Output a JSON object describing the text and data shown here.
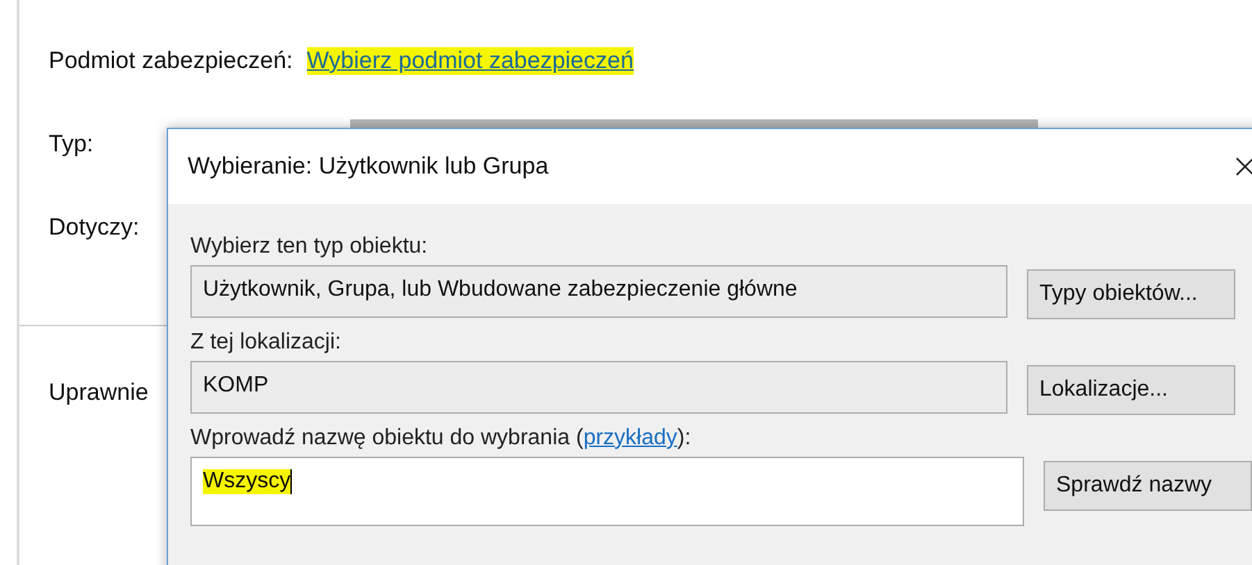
{
  "background_window": {
    "fields": [
      {
        "kind": "link",
        "label": "Podmiot zabezpieczeń:",
        "value": "Wybierz podmiot zabezpieczeń",
        "highlighted": true
      },
      {
        "kind": "text",
        "label": "Typ:"
      },
      {
        "kind": "text",
        "label": "Dotyczy:"
      }
    ],
    "group_label": "Uprawnie"
  },
  "dialog": {
    "title": "Wybieranie: Użytkownik lub Grupa",
    "rows": [
      {
        "label": "Wybierz ten typ obiektu:",
        "kind": "readonly",
        "value": "Użytkownik, Grupa, lub Wbudowane zabezpieczenie główne",
        "button": "Typy obiektów..."
      },
      {
        "label": "Z tej lokalizacji:",
        "kind": "readonly",
        "value": "KOMP",
        "button": "Lokalizacje..."
      },
      {
        "label": "Wprowadź nazwę obiektu do wybrania (",
        "link": "przykłady",
        "label_end": "):",
        "kind": "input",
        "value": "Wszyscy",
        "highlighted": true,
        "button": "Sprawdź nazwy"
      }
    ]
  }
}
